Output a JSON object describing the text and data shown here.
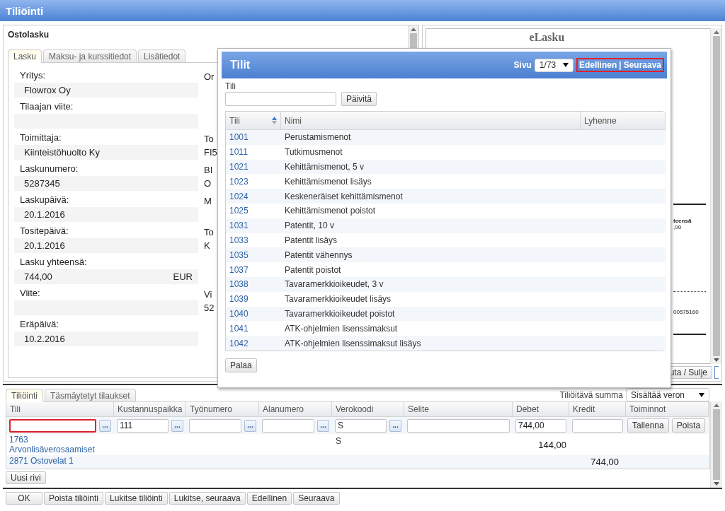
{
  "window": {
    "title": "Tiliöinti"
  },
  "invoice": {
    "title": "Ostolasku",
    "tabs": [
      {
        "label": "Lasku",
        "selected": true
      },
      {
        "label": "Maksu- ja kurssitiedot",
        "selected": false
      },
      {
        "label": "Lisätiedot",
        "selected": false
      }
    ],
    "fields": [
      {
        "label": "Yritys:",
        "value": "Flowrox Oy",
        "side_label": "Or"
      },
      {
        "label": "Tilaajan viite:"
      },
      {
        "label": "Toimittaja:",
        "value": "Kiinteistöhuolto Ky",
        "side_label": "To",
        "side_value": "FI5"
      },
      {
        "label": "Laskunumero:",
        "value": "5287345",
        "side_label": "BI",
        "side_value": "O"
      },
      {
        "label": "Laskupäivä:",
        "value": "20.1.2016",
        "side_label": "M"
      },
      {
        "label": "Tositepäivä:",
        "value": "20.1.2016",
        "side_label": "To",
        "side_value": "K"
      },
      {
        "label": "Lasku yhteensä:",
        "value": "744,00",
        "unit": "EUR"
      },
      {
        "label": "Viite:",
        "side_label": "Vi",
        "side_value": "52"
      },
      {
        "label": "Eräpäivä:",
        "value": "10.2.2016"
      }
    ]
  },
  "preview": {
    "heading": "eLasku",
    "fragments": [
      "teensä",
      ",00",
      "00575160"
    ],
    "button": "uta / Sulje"
  },
  "posting": {
    "tabs": [
      {
        "label": "Tiliöinti",
        "selected": true
      },
      {
        "label": "Täsmäytetyt tilaukset",
        "selected": false
      }
    ],
    "amount_label": "Tiliöitävä summa",
    "amount_select": "Sisältää veron",
    "columns": [
      "Tili",
      "Kustannuspaikka",
      "Työnumero",
      "Alanumero",
      "Verokoodi",
      "Selite",
      "Debet",
      "Kredit",
      "Toiminnot"
    ],
    "input_row": [
      {
        "kind": "input",
        "lookup": "...",
        "highlighted": true
      },
      {
        "kind": "input",
        "value": "111",
        "lookup": "...",
        "highlighted": false
      },
      {
        "kind": "input",
        "lookup": "...",
        "highlighted": false
      },
      {
        "kind": "input",
        "lookup": "...",
        "highlighted": false
      },
      {
        "kind": "input",
        "value": "S",
        "lookup": "...",
        "highlighted": false
      },
      {
        "kind": "input",
        "highlighted": false
      },
      {
        "kind": "input",
        "value": "744,00",
        "highlighted": false
      },
      {
        "kind": "input",
        "highlighted": false
      },
      {
        "kind": "buttons",
        "buttons": [
          "Tallenna",
          "Poista"
        ]
      }
    ],
    "lines": [
      {
        "account": "1763 Arvonlisäverosaamiset",
        "vat_code": "S",
        "debet": "144,00"
      },
      {
        "account": "2871 Ostovelat 1",
        "kredit": "744,00"
      }
    ],
    "new_row_button": "Uusi rivi"
  },
  "footer_buttons": [
    "OK",
    "Poista tiliöinti",
    "Lukitse tiliöinti",
    "Lukitse, seuraava",
    "Edellinen",
    "Seuraava"
  ],
  "dialog": {
    "title": "Tilit",
    "page_label": "Sivu",
    "page_select": "1/73",
    "pager": {
      "previous": "Edellinen",
      "separator": "|",
      "next": "Seuraava",
      "highlighted": true
    },
    "search_label": "Tili",
    "search_button": "Päivitä",
    "columns": [
      "Tili",
      "Nimi",
      "Lyhenne"
    ],
    "rows": [
      {
        "tili": "1001",
        "nimi": "Perustamismenot"
      },
      {
        "tili": "1011",
        "nimi": "Tutkimusmenot"
      },
      {
        "tili": "1021",
        "nimi": "Kehittämismenot, 5 v"
      },
      {
        "tili": "1023",
        "nimi": "Kehittämismenot lisäys"
      },
      {
        "tili": "1024",
        "nimi": "Keskeneräiset kehittämismenot"
      },
      {
        "tili": "1025",
        "nimi": "Kehittämismenot poistot"
      },
      {
        "tili": "1031",
        "nimi": "Patentit, 10 v"
      },
      {
        "tili": "1033",
        "nimi": "Patentit lisäys"
      },
      {
        "tili": "1035",
        "nimi": "Patentit vähennys"
      },
      {
        "tili": "1037",
        "nimi": "Patentit poistot"
      },
      {
        "tili": "1038",
        "nimi": "Tavaramerkkioikeudet, 3 v"
      },
      {
        "tili": "1039",
        "nimi": "Tavaramerkkioikeudet lisäys"
      },
      {
        "tili": "1040",
        "nimi": "Tavaramerkkioikeudet poistot"
      },
      {
        "tili": "1041",
        "nimi": "ATK-ohjelmien lisenssimaksut"
      },
      {
        "tili": "1042",
        "nimi": "ATK-ohjelmien lisenssimaksut lisäys"
      }
    ],
    "back_button": "Palaa"
  }
}
